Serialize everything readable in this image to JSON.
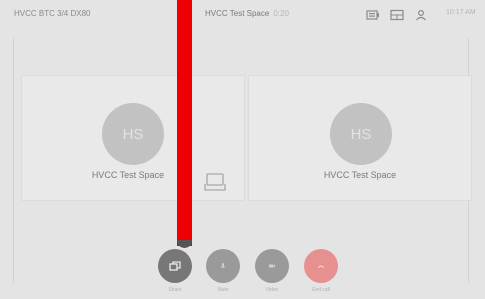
{
  "header": {
    "device_label": "HVCC BTC 3/4 DX80",
    "meeting_title": "HVCC Test Space",
    "duration": "0:20",
    "time": "10:17 AM",
    "icons": [
      "camera-icon",
      "layout-icon",
      "participants-icon"
    ]
  },
  "participants": [
    {
      "initials": "HS",
      "name": "HVCC Test Space"
    },
    {
      "initials": "HS",
      "name": "HVCC Test Space"
    }
  ],
  "share_tray": {
    "icon": "share-tray-icon"
  },
  "controls": [
    {
      "label": "Share",
      "icon": "share-screen-icon",
      "color": "#777777"
    },
    {
      "label": "Mute",
      "icon": "microphone-icon",
      "color": "#9a9a9a"
    },
    {
      "label": "Video",
      "icon": "video-icon",
      "color": "#9a9a9a"
    },
    {
      "label": "End call",
      "icon": "end-call-icon",
      "color": "#e79090"
    }
  ],
  "overlay": {
    "bar_color": "#ee0000"
  }
}
